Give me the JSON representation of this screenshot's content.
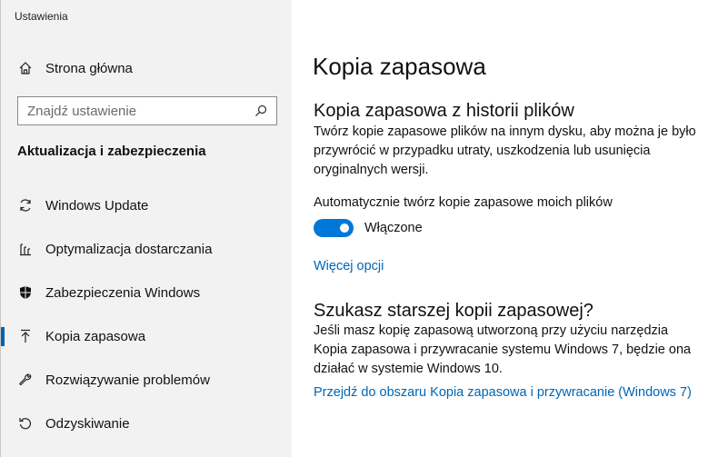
{
  "window": {
    "title": "Ustawienia"
  },
  "sidebar": {
    "home_label": "Strona główna",
    "search": {
      "placeholder": "Znajdź ustawienie",
      "value": ""
    },
    "section_title": "Aktualizacja i zabezpieczenia",
    "items": [
      {
        "label": "Windows Update",
        "icon": "sync-icon",
        "selected": false
      },
      {
        "label": "Optymalizacja dostarczania",
        "icon": "delivery-optimization-icon",
        "selected": false
      },
      {
        "label": "Zabezpieczenia Windows",
        "icon": "shield-icon",
        "selected": false
      },
      {
        "label": "Kopia zapasowa",
        "icon": "backup-upload-icon",
        "selected": true
      },
      {
        "label": "Rozwiązywanie problemów",
        "icon": "wrench-icon",
        "selected": false
      },
      {
        "label": "Odzyskiwanie",
        "icon": "recovery-icon",
        "selected": false
      }
    ]
  },
  "main": {
    "title": "Kopia zapasowa",
    "file_history": {
      "heading": "Kopia zapasowa z historii plików",
      "description": "Twórz kopie zapasowe plików na innym dysku, aby można je było przywrócić w przypadku utraty, uszkodzenia lub usunięcia oryginalnych wersji.",
      "auto_label": "Automatycznie twórz kopie zapasowe moich plików",
      "toggle_on": true,
      "toggle_state": "Włączone",
      "more_options": "Więcej opcji"
    },
    "older_backup": {
      "heading": "Szukasz starszej kopii zapasowej?",
      "description": "Jeśli masz kopię zapasową utworzoną przy użyciu narzędzia Kopia zapasowa i przywracanie systemu Windows 7, będzie ona działać w systemie Windows 10.",
      "link": "Przejdź do obszaru Kopia zapasowa i przywracanie (Windows 7)"
    }
  },
  "colors": {
    "accent": "#0078d7",
    "link": "#0066b4",
    "sidebar_bg": "#f2f2f2"
  }
}
